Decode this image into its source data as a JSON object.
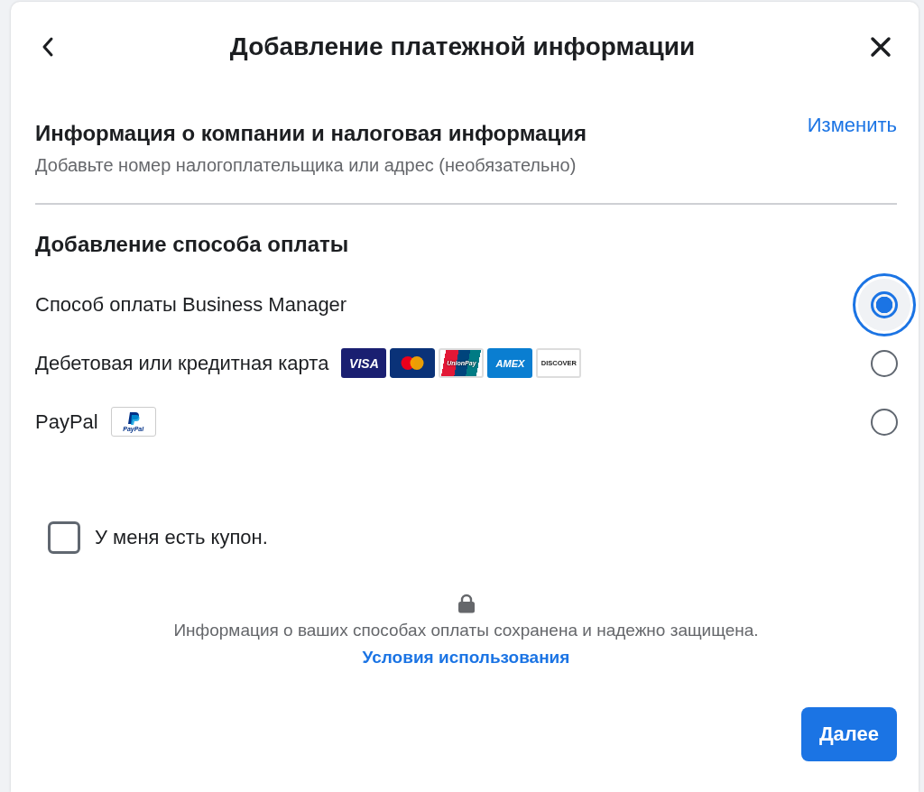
{
  "dialog": {
    "title": "Добавление платежной информации"
  },
  "company": {
    "title": "Информация о компании и налоговая информация",
    "subtitle": "Добавьте номер налогоплательщика или адрес (необязательно)",
    "edit_link": "Изменить"
  },
  "payment": {
    "title": "Добавление способа оплаты",
    "options": [
      {
        "label": "Способ оплаты Business Manager",
        "selected": true,
        "focused": true
      },
      {
        "label": "Дебетовая или кредитная карта",
        "selected": false,
        "focused": false,
        "logos": [
          {
            "kind": "visa",
            "text": "VISA"
          },
          {
            "kind": "mastercard"
          },
          {
            "kind": "unionpay",
            "text": "UnionPay"
          },
          {
            "kind": "amex",
            "text": "AMEX"
          },
          {
            "kind": "discover",
            "text": "DISCOVER"
          }
        ]
      },
      {
        "label": "PayPal",
        "selected": false,
        "focused": false,
        "logos": [
          {
            "kind": "paypal",
            "text": "PayPal"
          }
        ]
      }
    ]
  },
  "coupon": {
    "label": "У меня есть купон.",
    "checked": false
  },
  "security": {
    "text": "Информация о ваших способах оплаты сохранена и надежно защищена.",
    "terms_link": "Условия использования"
  },
  "next_button": "Далее"
}
